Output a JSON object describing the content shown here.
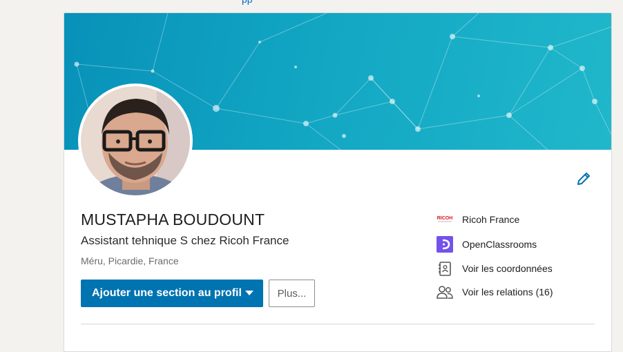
{
  "top_nav": {
    "partial_text": "pp"
  },
  "profile": {
    "name": "MUSTAPHA BOUDOUNT",
    "headline": "Assistant tehnique S chez Ricoh France",
    "location": "Méru, Picardie, France"
  },
  "actions": {
    "primary_label": "Ajouter une section au profil",
    "secondary_label": "Plus..."
  },
  "side_panel": {
    "items": [
      {
        "label": "Ricoh France",
        "icon": "ricoh-logo-icon",
        "logo_text": "RICOH"
      },
      {
        "label": "OpenClassrooms",
        "icon": "openclassrooms-logo-icon"
      },
      {
        "label": "Voir les coordonnées",
        "icon": "contact-card-icon"
      },
      {
        "label": "Voir les relations (16)",
        "icon": "people-icon"
      }
    ]
  },
  "colors": {
    "primary_button": "#0073b1",
    "banner_start": "#0891b9",
    "banner_end": "#20b7cb",
    "ricoh_red": "#d7171f",
    "openclassrooms_purple": "#7451eb",
    "edit_icon": "#0073b1"
  }
}
